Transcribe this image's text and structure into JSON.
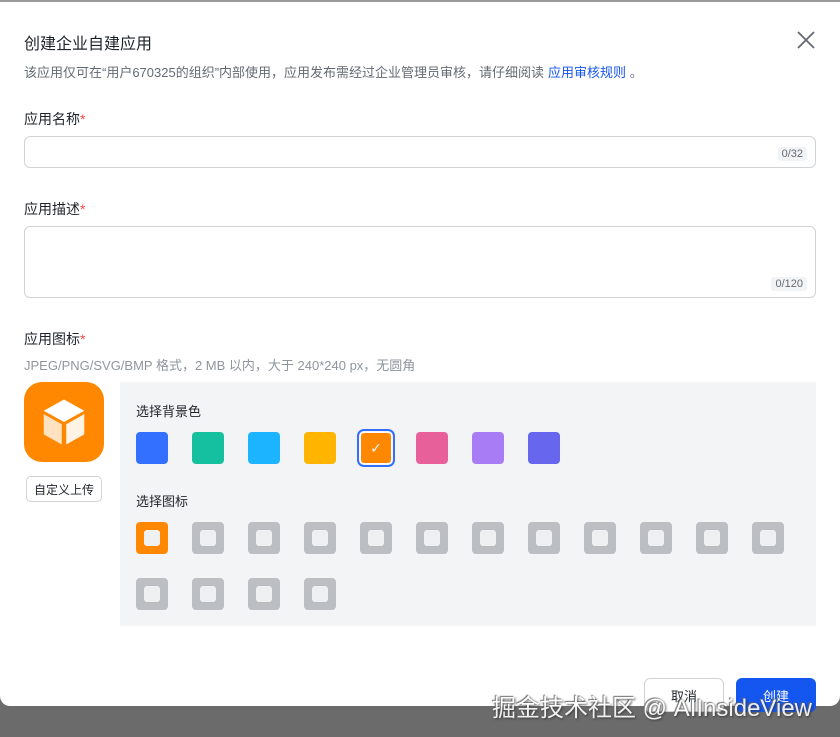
{
  "dialog": {
    "title": "创建企业自建应用",
    "description": "该应用仅可在“用户670325的组织”内部使用，应用发布需经过企业管理员审核，请仔细阅读",
    "rules_link": "应用审核规则",
    "period": "。"
  },
  "name_field": {
    "label": "应用名称",
    "required": "*",
    "value": "",
    "counter": "0/32"
  },
  "desc_field": {
    "label": "应用描述",
    "required": "*",
    "value": "",
    "counter": "0/120"
  },
  "icon_field": {
    "label": "应用图标",
    "required": "*",
    "hint": "JPEG/PNG/SVG/BMP 格式，2 MB 以内，大于 240*240 px，无圆角",
    "upload_label": "自定义上传"
  },
  "bg_colors": {
    "label": "选择背景色",
    "selected_index": 4,
    "colors": [
      "#3370ff",
      "#14c0a0",
      "#1cb4ff",
      "#ffb400",
      "#ff8800",
      "#e8609a",
      "#a77cf5",
      "#6666ee"
    ],
    "check": "✓"
  },
  "icons": {
    "label": "选择图标",
    "selected_index": 0,
    "items": [
      "cube-icon",
      "robot-icon",
      "lightbulb-icon",
      "door-icon",
      "briefcase-icon",
      "bell-icon",
      "bookmark-check-icon",
      "pie-chart-icon",
      "star-icon",
      "tag-icon",
      "wrench-icon",
      "document-icon",
      "shield-check-icon",
      "layout-icon",
      "users-icon",
      "code-icon"
    ]
  },
  "footer": {
    "cancel": "取消",
    "create": "创建"
  },
  "watermark": "掘金技术社区 @ AIInsideView"
}
